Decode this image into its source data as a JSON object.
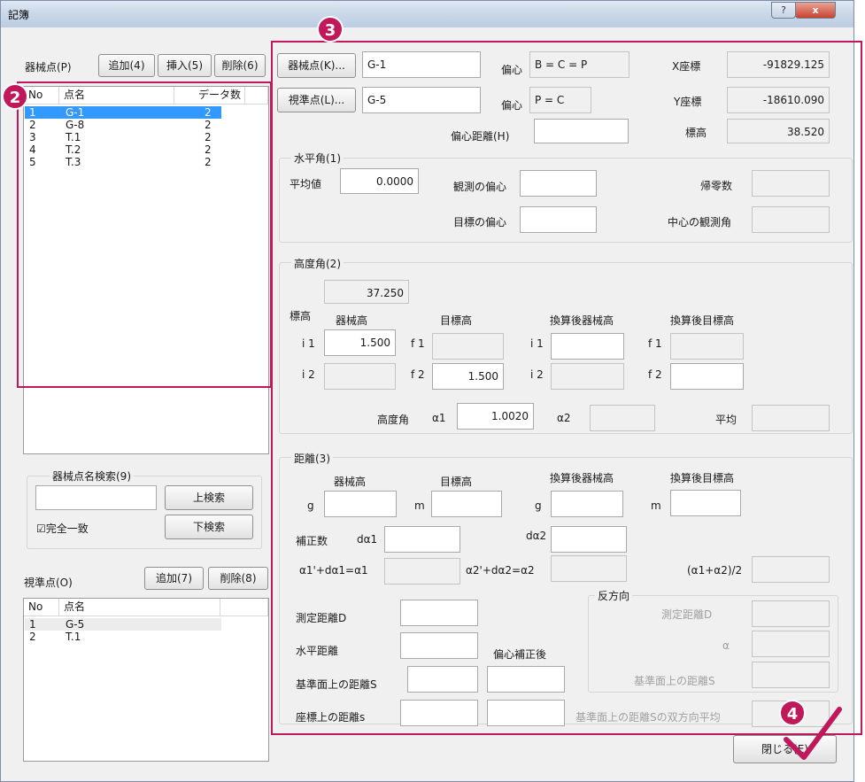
{
  "window": {
    "title": "記簿",
    "help_button": "?",
    "close_button": "x"
  },
  "left": {
    "instrument_label": "器械点(P)",
    "add_button": "追加(4)",
    "insert_button": "挿入(5)",
    "delete_button": "削除(6)",
    "instrument_list": {
      "headers": [
        "No",
        "点名",
        "データ数"
      ],
      "rows": [
        {
          "no": "1",
          "name": "G-1",
          "count": "2"
        },
        {
          "no": "2",
          "name": "G-8",
          "count": "2"
        },
        {
          "no": "3",
          "name": "T.1",
          "count": "2"
        },
        {
          "no": "4",
          "name": "T.2",
          "count": "2"
        },
        {
          "no": "5",
          "name": "T.3",
          "count": "2"
        }
      ],
      "selected_index": 0
    },
    "search": {
      "group_title": "器械点名検索(9)",
      "input_value": "",
      "up_button": "上検索",
      "down_button": "下検索",
      "exact_match_label": "完全一致",
      "exact_match_checked": true
    },
    "sight_label": "視準点(O)",
    "sight_add_button": "追加(7)",
    "sight_delete_button": "削除(8)",
    "sight_list": {
      "headers": [
        "No",
        "点名"
      ],
      "rows": [
        {
          "no": "1",
          "name": "G-5"
        },
        {
          "no": "2",
          "name": "T.1"
        }
      ],
      "highlighted_index": 0
    }
  },
  "top": {
    "instrument_point_button": "器械点(K)...",
    "instrument_point_value": "G-1",
    "sight_point_button": "視準点(L)...",
    "sight_point_value": "G-5",
    "eccentric1_label": "偏心",
    "eccentric1_value": "B = C = P",
    "eccentric2_label": "偏心",
    "eccentric2_value": "P = C",
    "eccentric_distance_label": "偏心距離(H)",
    "eccentric_distance_value": "",
    "x_label": "X座標",
    "x_value": "-91829.125",
    "y_label": "Y座標",
    "y_value": "-18610.090",
    "height_label": "標高",
    "height_value": "38.520"
  },
  "horizontal": {
    "title": "水平角(1)",
    "avg_label": "平均値",
    "avg_value": "0.0000",
    "obs_ecc_label": "観測の偏心",
    "obs_ecc_value": "",
    "return_label": "帰零数",
    "return_value": "",
    "target_ecc_label": "目標の偏心",
    "target_ecc_value": "",
    "center_angle_label": "中心の観測角",
    "center_angle_value": ""
  },
  "vertical": {
    "title": "高度角(2)",
    "height_label": "標高",
    "height_value": "37.250",
    "col1": "器械高",
    "col2": "目標高",
    "col3": "換算後器械高",
    "col4": "換算後目標高",
    "i1_label": "i 1",
    "i1_value": "1.500",
    "f1_label": "f 1",
    "f1_value": "",
    "ci1_label": "i 1",
    "ci1_value": "",
    "cf1_label": "f 1",
    "cf1_value": "",
    "i2_label": "i 2",
    "i2_value": "",
    "f2_label": "f 2",
    "f2_value": "1.500",
    "ci2_label": "i 2",
    "ci2_value": "",
    "cf2_label": "f 2",
    "cf2_value": "",
    "angle_label": "高度角",
    "a1_label": "α1",
    "a1_value": "1.0020",
    "a2_label": "α2",
    "a2_value": "",
    "avg_label": "平均",
    "avg_value": ""
  },
  "distance": {
    "title": "距離(3)",
    "col1": "器械高",
    "col2": "目標高",
    "col3": "換算後器械高",
    "col4": "換算後目標高",
    "g_label": "g",
    "m_label": "m",
    "cg_label": "g",
    "cm_label": "m",
    "corr_label": "補正数",
    "da1_label": "dα1",
    "da2_label": "dα2",
    "a1p_label": "α1'+dα1=α1",
    "a2p_label": "α2'+dα2=α2",
    "avg_label": "(α1+α2)/2",
    "measured_label": "測定距離D",
    "horizontal_label": "水平距離",
    "after_ecc_label": "偏心補正後",
    "base_label": "基準面上の距離S",
    "coord_label": "座標上の距離s",
    "reverse": {
      "title": "反方向",
      "measured_label": "測定距離D",
      "alpha_label": "α",
      "base_label": "基準面上の距離S"
    },
    "bidirectional_label": "基準面上の距離Sの双方向平均"
  },
  "close_button": "閉じる(E)",
  "annotations": {
    "badge2": "2",
    "badge3": "3",
    "badge4": "4",
    "frame_color": "#c0185a"
  }
}
